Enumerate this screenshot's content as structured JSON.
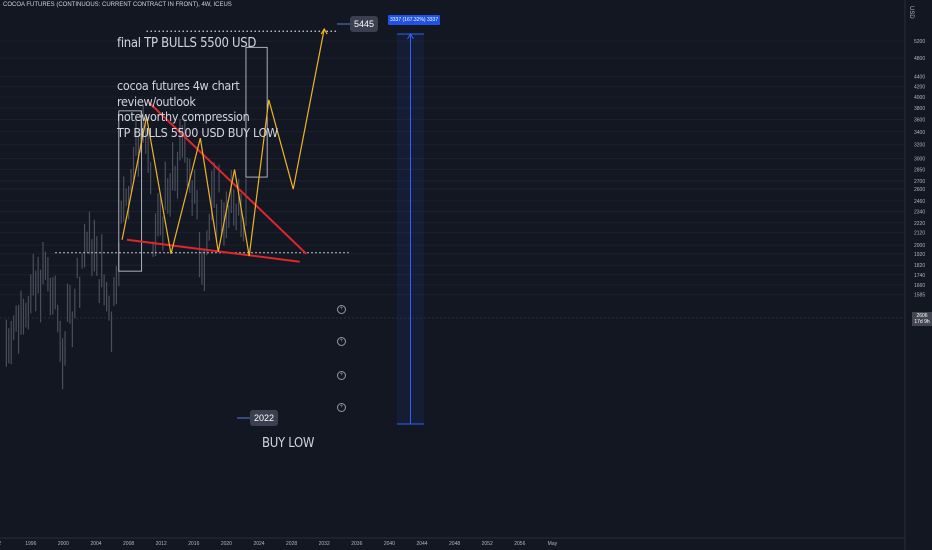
{
  "header": {
    "title": "COCOA FUTURES (CONTINUOUS: CURRENT CONTRACT IN FRONT), 4W, ICEUS"
  },
  "notes": {
    "final_tp": "final TP BULLS 5500 USD",
    "lines": [
      "cocoa futures 4w chart",
      "review/outlook",
      "noteworthy compression",
      "TP BULLS 5500 USD BUY LOW"
    ],
    "buy_low": "BUY LOW"
  },
  "tags": {
    "target": "5445",
    "low": "2022"
  },
  "measure_tag": "3337 (167.32%) 3337",
  "price_tag": [
    "2606",
    "17d 9h"
  ],
  "currency_label": "USD",
  "icons": [
    "plus-circle-icon",
    "plus-circle-icon",
    "plus-circle-icon",
    "plus-circle-icon"
  ],
  "colors": {
    "background": "#131722",
    "pattern": "#f0b429",
    "trendline": "#e0262b",
    "measure": "#2962ff",
    "candles": "#787b86"
  },
  "chart_data": {
    "type": "line",
    "title": "",
    "xlabel": "",
    "ylabel": "",
    "x_ticks": [
      "92",
      "1996",
      "2000",
      "2004",
      "2008",
      "2012",
      "2016",
      "2020",
      "2024",
      "2028",
      "2032",
      "2036",
      "2040",
      "2044",
      "2048",
      "2052",
      "2056",
      "May"
    ],
    "y_ticks": [
      1585,
      1660,
      1740,
      1820,
      1920,
      2000,
      2120,
      2220,
      2340,
      2460,
      2600,
      2700,
      2850,
      3000,
      3200,
      3400,
      3600,
      3800,
      4000,
      4200,
      4400,
      4800,
      5200
    ],
    "price_axis_labels": [
      "1585",
      "1660",
      "1740",
      "1820",
      "1920",
      "2000",
      "2120",
      "2220",
      "2340",
      "2460",
      "2600",
      "2700",
      "2850",
      "3000",
      "3200",
      "3400",
      "3600",
      "3800",
      "4000",
      "4200",
      "4400",
      "4800",
      "5200"
    ],
    "log_scale": true,
    "series": [
      {
        "x": [
          2007.2,
          2010.2,
          2013.2,
          2016.8,
          2019.0,
          2021.0,
          2022.8,
          2025.2,
          2028.2,
          2032.0
        ],
        "y": [
          2050,
          3650,
          1920,
          3300,
          1940,
          2850,
          1900,
          3950,
          2600,
          5500
        ]
      }
    ],
    "trendlines": [
      {
        "x": [
          2010.5,
          2029.8
        ],
        "y": [
          3900,
          1920
        ]
      },
      {
        "x": [
          2007.8,
          2029.0
        ],
        "y": [
          2050,
          1850
        ]
      }
    ],
    "levels": [
      {
        "y": 5445,
        "x": [
          2010.2,
          2033.5
        ]
      },
      {
        "y": 1930,
        "x": [
          1999.0,
          2035.0
        ]
      }
    ],
    "boxes": [
      {
        "x": [
          2006.8,
          2009.6
        ],
        "y": [
          1770,
          3750
        ]
      },
      {
        "x": [
          2022.4,
          2025.0
        ],
        "y": [
          2750,
          5050
        ]
      }
    ]
  }
}
